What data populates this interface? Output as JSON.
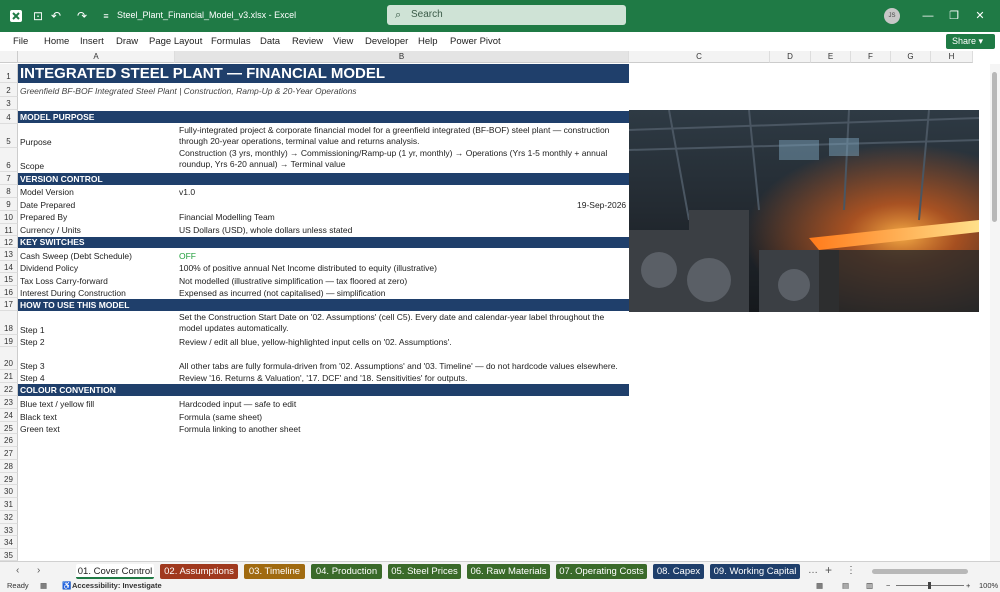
{
  "titlebar": {
    "doc_title": "Steel_Plant_Financial_Model_v3.xlsx  -  Excel",
    "search_placeholder": "Search",
    "avatar_initials": "JS"
  },
  "menu": [
    "File",
    "Home",
    "Insert",
    "Draw",
    "Page Layout",
    "Formulas",
    "Data",
    "Review",
    "View",
    "Developer",
    "Help",
    "Power Pivot"
  ],
  "share_label": "Share",
  "columns": [
    "A",
    "B",
    "C",
    "D",
    "E",
    "F",
    "G",
    "H"
  ],
  "rows": [
    "1",
    "2",
    "3",
    "4",
    "5",
    "6",
    "7",
    "8",
    "9",
    "10",
    "11",
    "12",
    "13",
    "14",
    "15",
    "16",
    "17",
    "18",
    "19",
    "20",
    "21",
    "22",
    "23",
    "24",
    "25",
    "26",
    "27",
    "28",
    "29",
    "30",
    "31",
    "32",
    "33",
    "34",
    "35"
  ],
  "sheet": {
    "title": "INTEGRATED STEEL PLANT — FINANCIAL MODEL",
    "subtitle": "Greenfield BF-BOF Integrated Steel Plant | Construction, Ramp-Up & 20-Year Operations",
    "section_purpose": "MODEL PURPOSE",
    "purpose_label": "Purpose",
    "purpose_text": "Fully-integrated project & corporate financial model for a greenfield integrated (BF-BOF) steel plant — construction through 20-year operations, terminal value and returns analysis.",
    "scope_label": "Scope",
    "scope_text": "Construction (3 yrs, monthly) → Commissioning/Ramp-up (1 yr, monthly) → Operations (Yrs 1-5 monthly + annual roundup, Yrs 6-20 annual) → Terminal value",
    "section_version": "VERSION CONTROL",
    "version_label": "Model Version",
    "version_value": "v1.0",
    "date_label": "Date Prepared",
    "date_value": "19-Sep-2026",
    "prepared_label": "Prepared By",
    "prepared_value": "Financial Modelling Team",
    "currency_label": "Currency / Units",
    "currency_value": "US Dollars (USD), whole dollars unless stated",
    "section_switches": "KEY SWITCHES",
    "cash_label": "Cash Sweep (Debt Schedule)",
    "cash_value": "OFF",
    "div_label": "Dividend Policy",
    "div_value": "100% of positive annual Net Income distributed to equity (illustrative)",
    "tax_label": "Tax Loss Carry-forward",
    "tax_value": "Not modelled (illustrative simplification — tax floored at zero)",
    "idc_label": "Interest During Construction",
    "idc_value": "Expensed as incurred (not capitalised) — simplification",
    "section_how": "HOW TO USE THIS MODEL",
    "step1_label": "Step 1",
    "step1_text": "Set the Construction Start Date on '02. Assumptions' (cell C5). Every date and calendar-year label throughout the model updates automatically.",
    "step2_label": "Step 2",
    "step2_text": "Review / edit all blue, yellow-highlighted input cells on '02. Assumptions'.",
    "step3_label": "Step 3",
    "step3_text": "All other tabs are fully formula-driven from '02. Assumptions' and '03. Timeline' — do not hardcode values elsewhere.",
    "step4_label": "Step 4",
    "step4_text": "Review '16. Returns & Valuation', '17. DCF' and '18. Sensitivities' for outputs.",
    "section_colour": "COLOUR CONVENTION",
    "blue_label": "Blue text / yellow fill",
    "blue_value": "Hardcoded input — safe to edit",
    "black_label": "Black text",
    "black_value": "Formula (same sheet)",
    "green_label": "Green text",
    "green_value": "Formula linking to another sheet"
  },
  "tabs": [
    {
      "label": "01. Cover Control",
      "color": "#ffffff"
    },
    {
      "label": "02. Assumptions",
      "color": "#a0391e"
    },
    {
      "label": "03. Timeline",
      "color": "#a06a10"
    },
    {
      "label": "04. Production",
      "color": "#3a6a2a"
    },
    {
      "label": "05. Steel Prices",
      "color": "#3a6a2a"
    },
    {
      "label": "06. Raw Materials",
      "color": "#3a6a2a"
    },
    {
      "label": "07. Operating Costs",
      "color": "#3a6a2a"
    },
    {
      "label": "08. Capex",
      "color": "#1f3f6b"
    },
    {
      "label": "09. Working Capital",
      "color": "#1f3f6b"
    }
  ],
  "status": {
    "ready": "Ready",
    "accessibility": "Accessibility: Investigate",
    "zoom": "100%"
  }
}
